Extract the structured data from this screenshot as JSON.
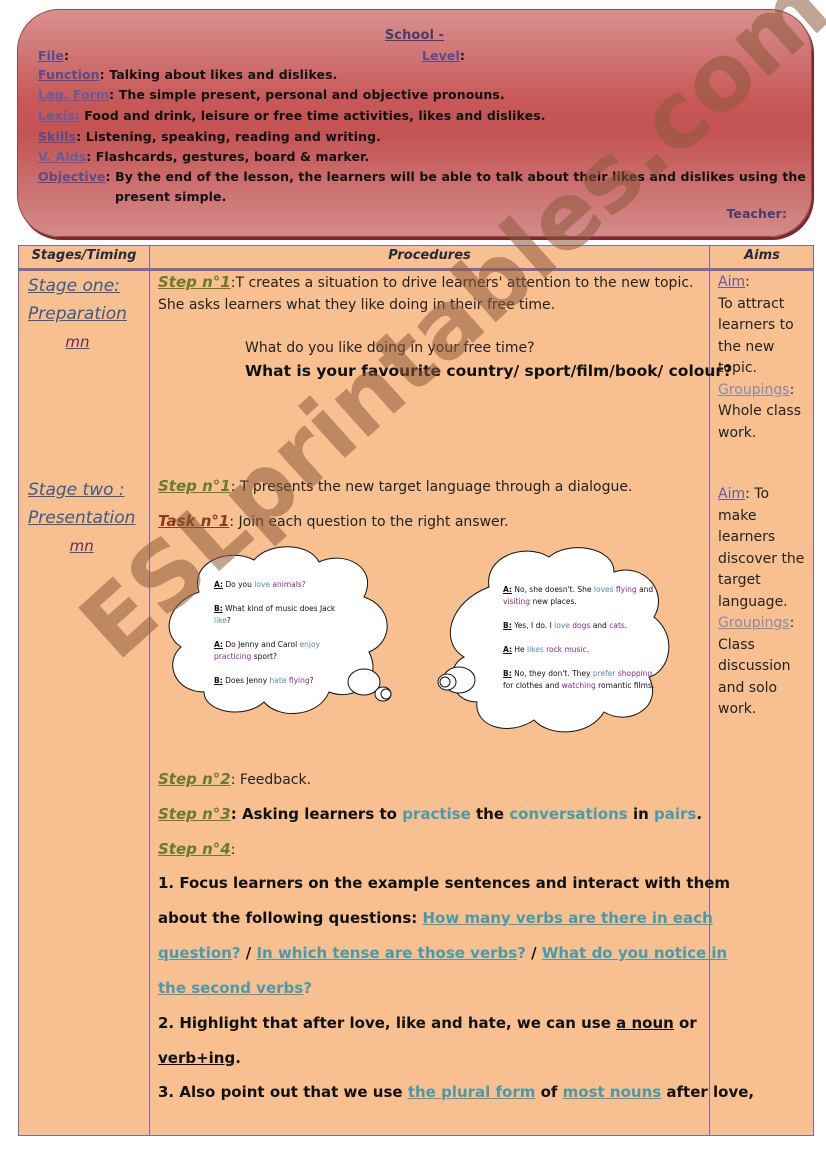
{
  "header": {
    "school": "School -",
    "file_label": "File",
    "level_label": "Level",
    "function_label": "Function",
    "function_value": ": Talking about likes and dislikes.",
    "lang_form_label": "Lag. Form",
    "lang_form_value": ": The simple present, personal and objective pronouns.",
    "lexis_label": "Lexis:",
    "lexis_value": " Food and drink, leisure or free time activities, likes and dislikes.",
    "skills_label": "Skills",
    "skills_value": ":  Listening, speaking, reading and writing.",
    "aids_label": "V. Aids",
    "aids_value": ": Flashcards, gestures, board & marker.",
    "objective_label": "Objective",
    "objective_value_1": ":  By the end of the lesson, the learners will be able to talk about their likes and dislikes using the",
    "objective_value_2": "present simple.",
    "teacher_label": "Teacher:"
  },
  "table": {
    "columns": [
      "Stages/Timing",
      "Procedures",
      "Aims"
    ],
    "stage_one": {
      "title_1": "Stage one:",
      "title_2": "Preparation",
      "timing": "mn"
    },
    "stage_two": {
      "title_1": "Stage two :",
      "title_2": "Presentation",
      "timing": "mn"
    },
    "preparation": {
      "step1_label": "Step n°1",
      "step1_text": ":T creates a situation to drive learners' attention to the new topic.",
      "step1_text2": "She asks learners what they like doing in their free time.",
      "question1": "What do you like doing in your free time?",
      "question2": "What is your favourite country/ sport/film/book/ colour?"
    },
    "presentation": {
      "step1_label": "Step n°1",
      "step1_text": ": T presents the new target language through a dialogue.",
      "task1_label": "Task n°1",
      "task1_text": ": Join each question to the right answer.",
      "left_cloud": [
        {
          "speaker": "A:",
          "parts": [
            [
              "Do you ",
              ""
            ],
            [
              "love",
              "lb"
            ],
            [
              " animals?",
              "pu"
            ]
          ]
        },
        {
          "speaker": "B:",
          "parts": [
            [
              "What kind of music does Jack ",
              ""
            ],
            [
              "like",
              "lb"
            ],
            [
              "?",
              ""
            ]
          ]
        },
        {
          "speaker": "A:",
          "parts": [
            [
              "Do Jenny and Carol ",
              ""
            ],
            [
              "enjoy",
              "lb"
            ],
            [
              " ",
              ""
            ],
            [
              "practicing",
              "pu"
            ],
            [
              " sport?",
              ""
            ]
          ]
        },
        {
          "speaker": "B:",
          "parts": [
            [
              "Does Jenny ",
              ""
            ],
            [
              "hate",
              "lb"
            ],
            [
              " ",
              ""
            ],
            [
              "flying",
              "pu"
            ],
            [
              "?",
              ""
            ]
          ]
        }
      ],
      "right_cloud": [
        {
          "speaker": "A:",
          "parts": [
            [
              "No, she doesn't. She ",
              ""
            ],
            [
              "loves",
              "lb"
            ],
            [
              " ",
              ""
            ],
            [
              "flying",
              "pu"
            ],
            [
              " and ",
              ""
            ],
            [
              "visiting",
              "pu"
            ],
            [
              " new places.",
              ""
            ]
          ]
        },
        {
          "speaker": "B:",
          "parts": [
            [
              "Yes, I do. I ",
              ""
            ],
            [
              "love",
              "lb"
            ],
            [
              " ",
              ""
            ],
            [
              "dogs",
              "pu"
            ],
            [
              " and ",
              ""
            ],
            [
              "cats",
              "pu"
            ],
            [
              ".",
              ""
            ]
          ]
        },
        {
          "speaker": "A:",
          "parts": [
            [
              "He ",
              ""
            ],
            [
              "likes",
              "lb"
            ],
            [
              " ",
              ""
            ],
            [
              "rock music",
              "pu"
            ],
            [
              ".",
              ""
            ]
          ]
        },
        {
          "speaker": "B:",
          "parts": [
            [
              "No, they don't. They ",
              ""
            ],
            [
              "prefer",
              "lb"
            ],
            [
              " ",
              ""
            ],
            [
              "shopping",
              "pu"
            ],
            [
              " for clothes and ",
              ""
            ],
            [
              "watching",
              "pu"
            ],
            [
              " romantic films.",
              ""
            ]
          ]
        }
      ],
      "step2_label": "Step n°2",
      "step2_text": ": Feedback.",
      "step3_label": "Step n°3",
      "step3_text_a": ": Asking learners to ",
      "step3_practise": "practise",
      "step3_text_b": " the ",
      "step3_conversations": "conversations",
      "step3_text_c": " in ",
      "step3_pairs": "pairs",
      "step3_text_d": ".",
      "step4_label": "Step n°4",
      "step4_colon": ":",
      "point1_a": "1. Focus learners on the example sentences and interact with them",
      "point1_b": "about the following questions: ",
      "point1_q1a": "How many verbs are there in each",
      "point1_q1b": "question",
      "point1_q2": "In which tense are those verbs",
      "point1_q3a": "What do you notice in",
      "point1_q3b": "the second verbs",
      "qmark": "?",
      "slash": " / ",
      "point2_a": "2. Highlight that after love, like and hate, we can use ",
      "point2_noun": "a noun",
      "point2_or": " or",
      "point2_verbing": "verb+ing",
      "point2_end": ".",
      "point3_a": "3. Also point out that we use ",
      "point3_plural": "the plural form",
      "point3_of": " of ",
      "point3_most": "most nouns",
      "point3_end": " after love,"
    },
    "aims": {
      "aim1_label": "Aim",
      "aim1_colon": ":",
      "aim1_text": "To attract learners to the new topic.",
      "group1_label": "Groupings",
      "group1_text": "Whole class work.",
      "aim2_label": "Aim",
      "aim2_text": ": To make learners discover the target language.",
      "group2_label": "Groupings",
      "group2_text": "Class discussion and solo work."
    }
  },
  "watermark": "ESLprintables.com"
}
